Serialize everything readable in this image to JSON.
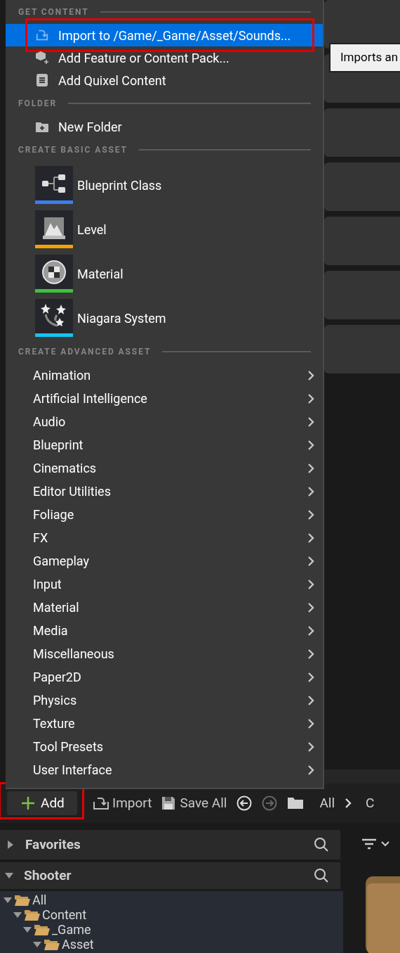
{
  "menu": {
    "sections": [
      {
        "kind": "list",
        "title": "GET CONTENT",
        "items": [
          {
            "label": "Import to /Game/_Game/Asset/Sounds...",
            "selected": true,
            "highlighted": true
          },
          {
            "label": "Add Feature or Content Pack...",
            "selected": false,
            "highlighted": false
          },
          {
            "label": "Add Quixel Content",
            "selected": false,
            "highlighted": false
          }
        ]
      },
      {
        "kind": "list",
        "title": "FOLDER",
        "items": [
          {
            "label": "New Folder",
            "selected": false,
            "highlighted": false
          }
        ]
      },
      {
        "kind": "tiles",
        "title": "CREATE BASIC ASSET",
        "items": [
          {
            "label": "Blueprint Class",
            "color": "#3b7cf0"
          },
          {
            "label": "Level",
            "color": "#f5a000"
          },
          {
            "label": "Material",
            "color": "#3cc23c"
          },
          {
            "label": "Niagara System",
            "color": "#16c4f0"
          }
        ]
      },
      {
        "kind": "submenus",
        "title": "CREATE ADVANCED ASSET",
        "items": [
          {
            "label": "Animation"
          },
          {
            "label": "Artificial Intelligence"
          },
          {
            "label": "Audio"
          },
          {
            "label": "Blueprint"
          },
          {
            "label": "Cinematics"
          },
          {
            "label": "Editor Utilities"
          },
          {
            "label": "Foliage"
          },
          {
            "label": "FX"
          },
          {
            "label": "Gameplay"
          },
          {
            "label": "Input"
          },
          {
            "label": "Material"
          },
          {
            "label": "Media"
          },
          {
            "label": "Miscellaneous"
          },
          {
            "label": "Paper2D"
          },
          {
            "label": "Physics"
          },
          {
            "label": "Texture"
          },
          {
            "label": "Tool Presets"
          },
          {
            "label": "User Interface"
          }
        ]
      }
    ]
  },
  "tooltip": "Imports an",
  "toolbar": {
    "add": {
      "label": "Add",
      "highlighted": true
    },
    "import": "Import",
    "save_all": "Save All",
    "back_disabled": false,
    "forward_disabled": true,
    "path": [
      "All",
      "C"
    ]
  },
  "favorites": {
    "title": "Favorites",
    "expanded": false
  },
  "collection": {
    "title": "Shooter",
    "expanded": true
  },
  "tree": [
    {
      "label": "All",
      "expanded": true,
      "children": [
        {
          "label": "Content",
          "expanded": true,
          "children": [
            {
              "label": "_Game",
              "expanded": true,
              "children": [
                {
                  "label": "Asset",
                  "expanded": true
                }
              ]
            }
          ]
        }
      ]
    }
  ]
}
